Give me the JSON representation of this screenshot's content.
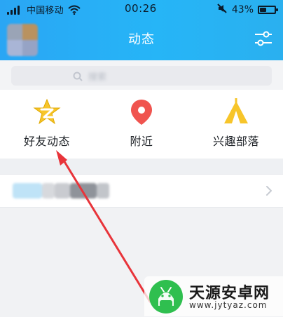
{
  "status_bar": {
    "carrier": "中国移动",
    "time": "00:26",
    "battery": "43%",
    "battery_level_percent": 43
  },
  "header": {
    "title": "动态"
  },
  "search": {
    "placeholder_blurred": "搜索"
  },
  "features": [
    {
      "label": "好友动态",
      "icon": "qzone-star-icon",
      "color": "#f7c52a"
    },
    {
      "label": "附近",
      "icon": "location-pin-icon",
      "color": "#f0544f"
    },
    {
      "label": "兴趣部落",
      "icon": "tent-icon",
      "color": "#f7c52a"
    }
  ],
  "list": {
    "items": [
      {
        "label_blurred": "",
        "chevron_icon": "chevron-right-icon"
      }
    ]
  },
  "annotation": {
    "arrow_color": "#e8343a"
  },
  "watermark": {
    "name": "天源安卓网",
    "url": "www.jytyaz.com"
  },
  "colors": {
    "header_gradient_start": "#2aa6f4",
    "header_gradient_end": "#2ab0ef",
    "page_background": "#f1f2f4",
    "card_background": "#ffffff"
  }
}
